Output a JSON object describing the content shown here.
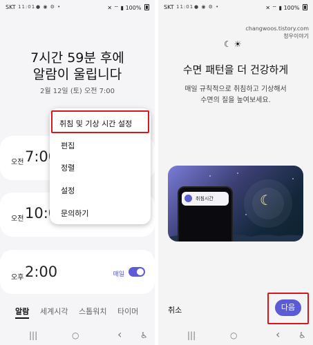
{
  "status": {
    "time": "11:01",
    "carrier": "SKT",
    "battery": "100%"
  },
  "left": {
    "headline_line1": "7시간 59분 후에",
    "headline_line2": "알람이 울립니다",
    "date": "2월 12일 (토) 오전 7:00",
    "alarms": [
      {
        "ampm": "오전",
        "time": "7:00"
      },
      {
        "ampm": "오전",
        "time": "10:00"
      },
      {
        "ampm": "오후",
        "time": "2:00",
        "repeat": "매일",
        "enabled": true
      }
    ],
    "menu": [
      "취침 및 기상 시간 설정",
      "편집",
      "정렬",
      "설정",
      "문의하기"
    ],
    "tabs": [
      "알람",
      "세계시각",
      "스톱워치",
      "타이머"
    ],
    "active_tab": "알람"
  },
  "right": {
    "watermark_url": "changwoos.tistory.com",
    "watermark_name": "청우이야기",
    "title": "수면 패턴을 더 건강하게",
    "desc_line1": "매일 규칙적으로 취침하고 기상해서",
    "desc_line2": "수면의 질을 높여보세요.",
    "illus_label": "취침시간",
    "cancel": "취소",
    "next": "다음"
  },
  "nav": {
    "recent": "|||",
    "home": "○",
    "back": "‹",
    "accessibility": "♿"
  },
  "colors": {
    "accent": "#5b5bd6",
    "highlight": "#d9161b"
  }
}
